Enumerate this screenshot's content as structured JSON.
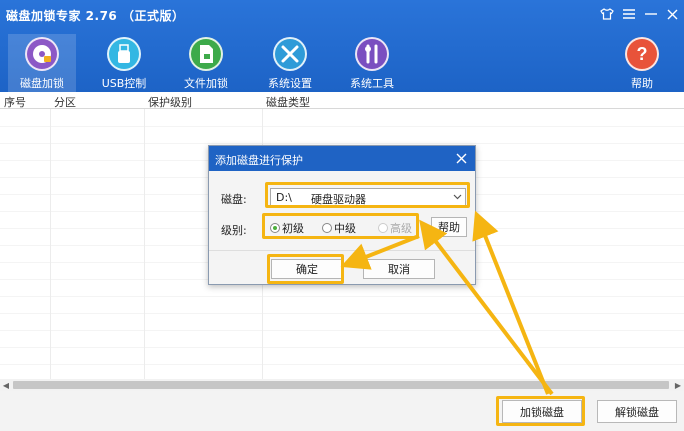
{
  "window": {
    "title": "磁盘加锁专家 2.76  （正式版）"
  },
  "toolbar": {
    "items": [
      {
        "label": "磁盘加锁"
      },
      {
        "label": "USB控制"
      },
      {
        "label": "文件加锁"
      },
      {
        "label": "系统设置"
      },
      {
        "label": "系统工具"
      },
      {
        "label": "帮助"
      }
    ]
  },
  "table": {
    "headers": [
      "序号",
      "分区",
      "保护级别",
      "磁盘类型"
    ]
  },
  "footer": {
    "lock_button": "加锁磁盘",
    "unlock_button": "解锁磁盘"
  },
  "dialog": {
    "title": "添加磁盘进行保护",
    "disk_label": "磁盘:",
    "disk_drive": "D:\\",
    "disk_type": "硬盘驱动器",
    "level_label": "级别:",
    "levels": [
      {
        "label": "初级",
        "selected": true,
        "enabled": true
      },
      {
        "label": "中级",
        "selected": false,
        "enabled": true
      },
      {
        "label": "高级",
        "selected": false,
        "enabled": false
      }
    ],
    "help_button": "帮助",
    "ok_button": "确定",
    "cancel_button": "取消"
  },
  "colors": {
    "header_blue": "#1d63c6",
    "annotation": "#f5b512"
  },
  "icons": [
    "tshirt-icon",
    "menu-icon",
    "minimize-icon",
    "disk-lock-icon",
    "usb-icon",
    "file-lock-icon",
    "settings-tools-icon",
    "system-tools-icon",
    "help-icon",
    "close-icon"
  ]
}
